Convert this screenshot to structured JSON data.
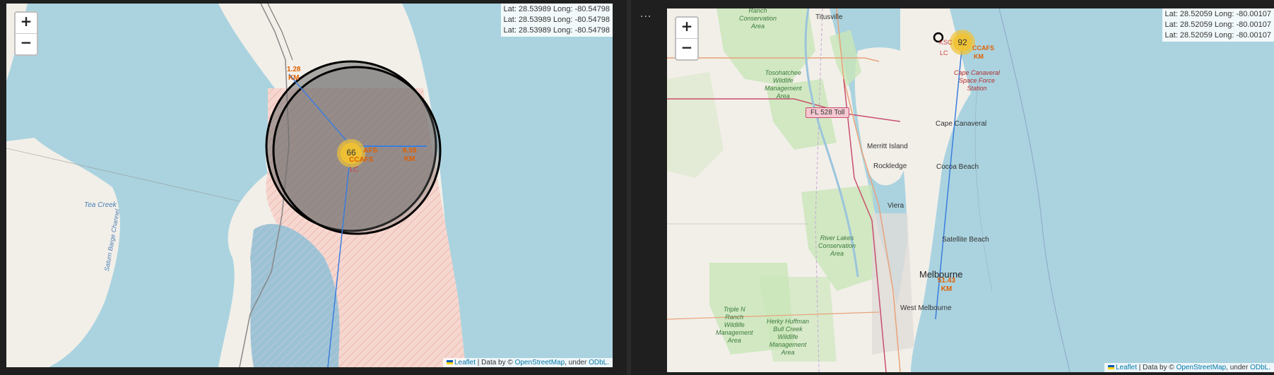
{
  "left_map": {
    "zoom_in_label": "+",
    "zoom_out_label": "−",
    "coords": [
      "Lat: 28.53989 Long: -80.54798",
      "Lat: 28.53989 Long: -80.54798",
      "Lat: 28.53989 Long: -80.54798"
    ],
    "cluster_count": "66",
    "labels": {
      "ccafs": "CCAFS",
      "afs": "AFS",
      "lc": "LC",
      "dist_a_1": "1.28",
      "dist_a_2": "KM",
      "dist_b_1": "6.59",
      "dist_b_2": "KM",
      "tea_creek": "Tea Creek",
      "channel": "Saturn Barge Channel"
    },
    "attribution": {
      "leaflet": "Leaflet",
      "data_by": "| Data by ©",
      "osm": "OpenStreetMap",
      "under": ", under",
      "odbl": "ODbL."
    }
  },
  "right_map": {
    "zoom_in_label": "+",
    "zoom_out_label": "−",
    "coords": [
      "Lat: 28.52059 Long: -80.00107",
      "Lat: 28.52059 Long: -80.00107",
      "Lat: 28.52059 Long: -80.00107"
    ],
    "cluster_count": "92",
    "labels": {
      "titusville": "Titusville",
      "ksc": "KSC",
      "lc": "LC",
      "ccafs": "CCAFS",
      "km": "KM",
      "ccsfs_1": "Cape Canaveral",
      "ccsfs_2": "Space Force",
      "ccsfs_3": "Station",
      "fl528": "FL 528 Toll",
      "cape_canaveral": "Cape Canaveral",
      "merritt_island": "Merritt Island",
      "rockledge": "Rockledge",
      "cocoa_beach": "Cocoa Beach",
      "viera": "Viera",
      "satellite_beach": "Satellite Beach",
      "melbourne": "Melbourne",
      "west_melbourne": "West Melbourne",
      "dist_1": "51.43",
      "dist_2": "KM",
      "ranch_1": "Ranch",
      "ranch_2": "Conservation",
      "ranch_3": "Area",
      "tosohatchee_1": "Tosohatchee",
      "tosohatchee_2": "Wildlife",
      "tosohatchee_3": "Management",
      "tosohatchee_4": "Area",
      "river_lakes_1": "River Lakes",
      "river_lakes_2": "Conservation",
      "river_lakes_3": "Area",
      "triple_n_1": "Triple N",
      "triple_n_2": "Ranch",
      "triple_n_3": "Wildlife",
      "triple_n_4": "Management",
      "triple_n_5": "Area",
      "herky_1": "Herky Huffman",
      "herky_2": "Bull Creek",
      "herky_3": "Wildlife",
      "herky_4": "Management",
      "herky_5": "Area"
    },
    "attribution": {
      "leaflet": "Leaflet",
      "data_by": "| Data by ©",
      "osm": "OpenStreetMap",
      "under": ", under",
      "odbl": "ODbL."
    }
  },
  "toolbar": {
    "more_label": "..."
  },
  "colors": {
    "water": "#aad3df",
    "land": "#f2efe9",
    "label_orange": "#e06000",
    "cluster": "#f1c232"
  }
}
